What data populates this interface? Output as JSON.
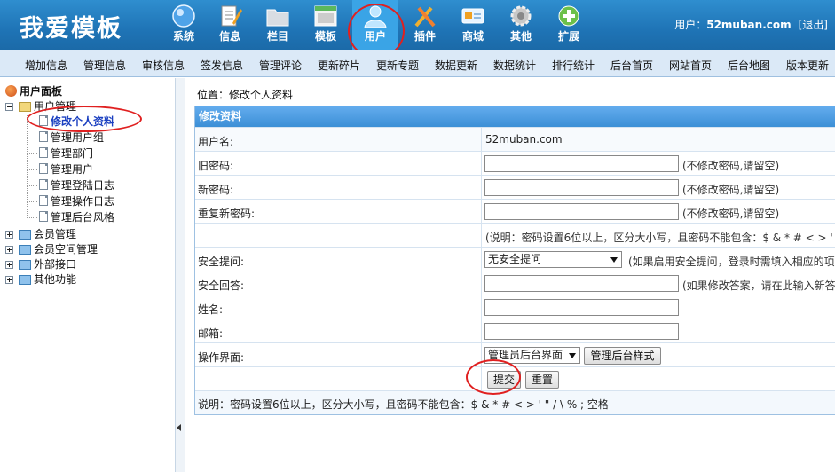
{
  "header": {
    "logo": "我爱模板",
    "user_prefix": "用户：",
    "username": "52muban.com",
    "logout": "[退出]"
  },
  "topnav": [
    {
      "label": "系统",
      "icon": "globe-icon"
    },
    {
      "label": "信息",
      "icon": "notepad-icon"
    },
    {
      "label": "栏目",
      "icon": "folder-icon"
    },
    {
      "label": "模板",
      "icon": "template-window-icon"
    },
    {
      "label": "用户",
      "icon": "user-icon",
      "active": true
    },
    {
      "label": "插件",
      "icon": "tools-icon"
    },
    {
      "label": "商城",
      "icon": "card-icon"
    },
    {
      "label": "其他",
      "icon": "gear-icon"
    },
    {
      "label": "扩展",
      "icon": "plus-icon"
    }
  ],
  "subnav": [
    "增加信息",
    "管理信息",
    "审核信息",
    "签发信息",
    "管理评论",
    "更新碎片",
    "更新专题",
    "数据更新",
    "数据统计",
    "排行统计",
    "后台首页",
    "网站首页",
    "后台地图",
    "版本更新"
  ],
  "sidebar": {
    "panel_title": "用户面板",
    "user_mgmt": "用户管理",
    "items": [
      "修改个人资料",
      "管理用户组",
      "管理部门",
      "管理用户",
      "管理登陆日志",
      "管理操作日志",
      "管理后台风格"
    ],
    "groups": [
      "会员管理",
      "会员空间管理",
      "外部接口",
      "其他功能"
    ]
  },
  "main": {
    "location": "位置：修改个人资料",
    "form_title": "修改资料",
    "username_label": "用户名:",
    "username_value": "52muban.com",
    "old_pw_label": "旧密码:",
    "old_pw_hint": "(不修改密码,请留空)",
    "new_pw_label": "新密码:",
    "new_pw_hint": "(不修改密码,请留空)",
    "repeat_pw_label": "重复新密码:",
    "repeat_pw_hint": "(不修改密码,请留空)",
    "pw_rule": "(说明：密码设置6位以上，区分大小写，且密码不能包含：$ & * # < > ' \"",
    "question_label": "安全提问:",
    "question_value": "无安全提问",
    "question_hint": "(如果启用安全提问，登录时需填入相应的项目",
    "answer_label": "安全回答:",
    "answer_hint": "(如果修改答案，请在此输入新答",
    "name_label": "姓名:",
    "email_label": "邮箱:",
    "ui_label": "操作界面:",
    "ui_value": "管理员后台界面",
    "style_button": "管理后台样式",
    "submit": "提交",
    "reset": "重置",
    "note": "说明：密码设置6位以上，区分大小写，且密码不能包含：$ & * # < > ' \" / \\ % ; 空格"
  }
}
